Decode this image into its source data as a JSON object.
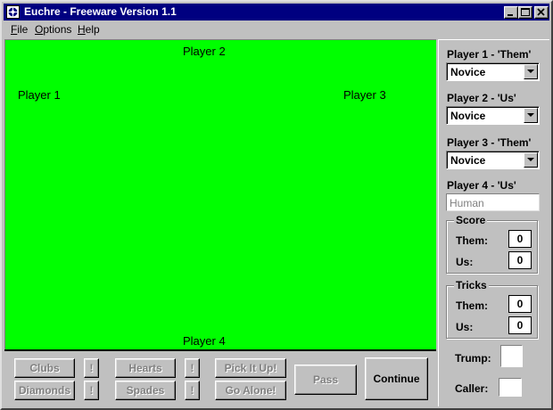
{
  "window": {
    "title": "Euchre - Freeware Version 1.1"
  },
  "menu": {
    "file": {
      "accel": "F",
      "rest": "ile"
    },
    "options": {
      "accel": "O",
      "rest": "ptions"
    },
    "help": {
      "accel": "H",
      "rest": "elp"
    }
  },
  "table": {
    "felt_color": "#00ff00",
    "player1": "Player 1",
    "player2": "Player 2",
    "player3": "Player 3",
    "player4": "Player 4"
  },
  "bottom": {
    "clubs": "Clubs",
    "diamonds": "Diamonds",
    "hearts": "Hearts",
    "spades": "Spades",
    "bang": "!",
    "pick_it_up": "Pick It Up!",
    "go_alone": "Go Alone!",
    "pass": "Pass",
    "continue": "Continue"
  },
  "side": {
    "p1_label": "Player 1 - 'Them'",
    "p1_level": "Novice",
    "p2_label": "Player 2 - 'Us'",
    "p2_level": "Novice",
    "p3_label": "Player 3 - 'Them'",
    "p3_level": "Novice",
    "p4_label": "Player 4 - 'Us'",
    "p4_value": "Human",
    "score": {
      "title": "Score",
      "them_label": "Them:",
      "them": "0",
      "us_label": "Us:",
      "us": "0"
    },
    "tricks": {
      "title": "Tricks",
      "them_label": "Them:",
      "them": "0",
      "us_label": "Us:",
      "us": "0"
    },
    "trump_label": "Trump:",
    "caller_label": "Caller:"
  }
}
